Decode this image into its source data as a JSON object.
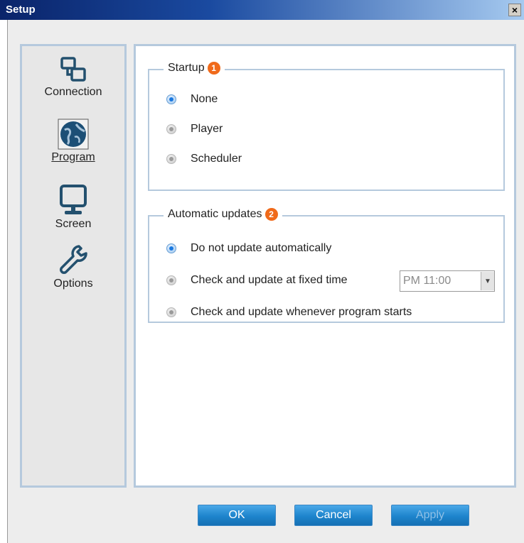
{
  "window": {
    "title": "Setup",
    "close_glyph": "×"
  },
  "sidebar": {
    "items": [
      {
        "label": "Connection",
        "icon": "connection-icon"
      },
      {
        "label": "Program",
        "icon": "globe-icon",
        "active": true
      },
      {
        "label": "Screen",
        "icon": "monitor-icon"
      },
      {
        "label": "Options",
        "icon": "wrench-icon"
      }
    ]
  },
  "startup": {
    "legend": "Startup",
    "badge": "1",
    "options": [
      {
        "label": "None",
        "checked": true
      },
      {
        "label": "Player",
        "checked": false
      },
      {
        "label": "Scheduler",
        "checked": false
      }
    ]
  },
  "updates": {
    "legend": "Automatic updates",
    "badge": "2",
    "options": [
      {
        "label": "Do not update automatically",
        "checked": true
      },
      {
        "label": "Check and update at fixed time",
        "checked": false
      },
      {
        "label": "Check and update whenever program starts",
        "checked": false
      }
    ],
    "time_value": "PM 11:00",
    "time_arrow": "▼"
  },
  "buttons": {
    "ok": "OK",
    "cancel": "Cancel",
    "apply": "Apply"
  },
  "colors": {
    "accent": "#1a78e0",
    "badge": "#f06a1a",
    "border": "#b5c9dd"
  }
}
